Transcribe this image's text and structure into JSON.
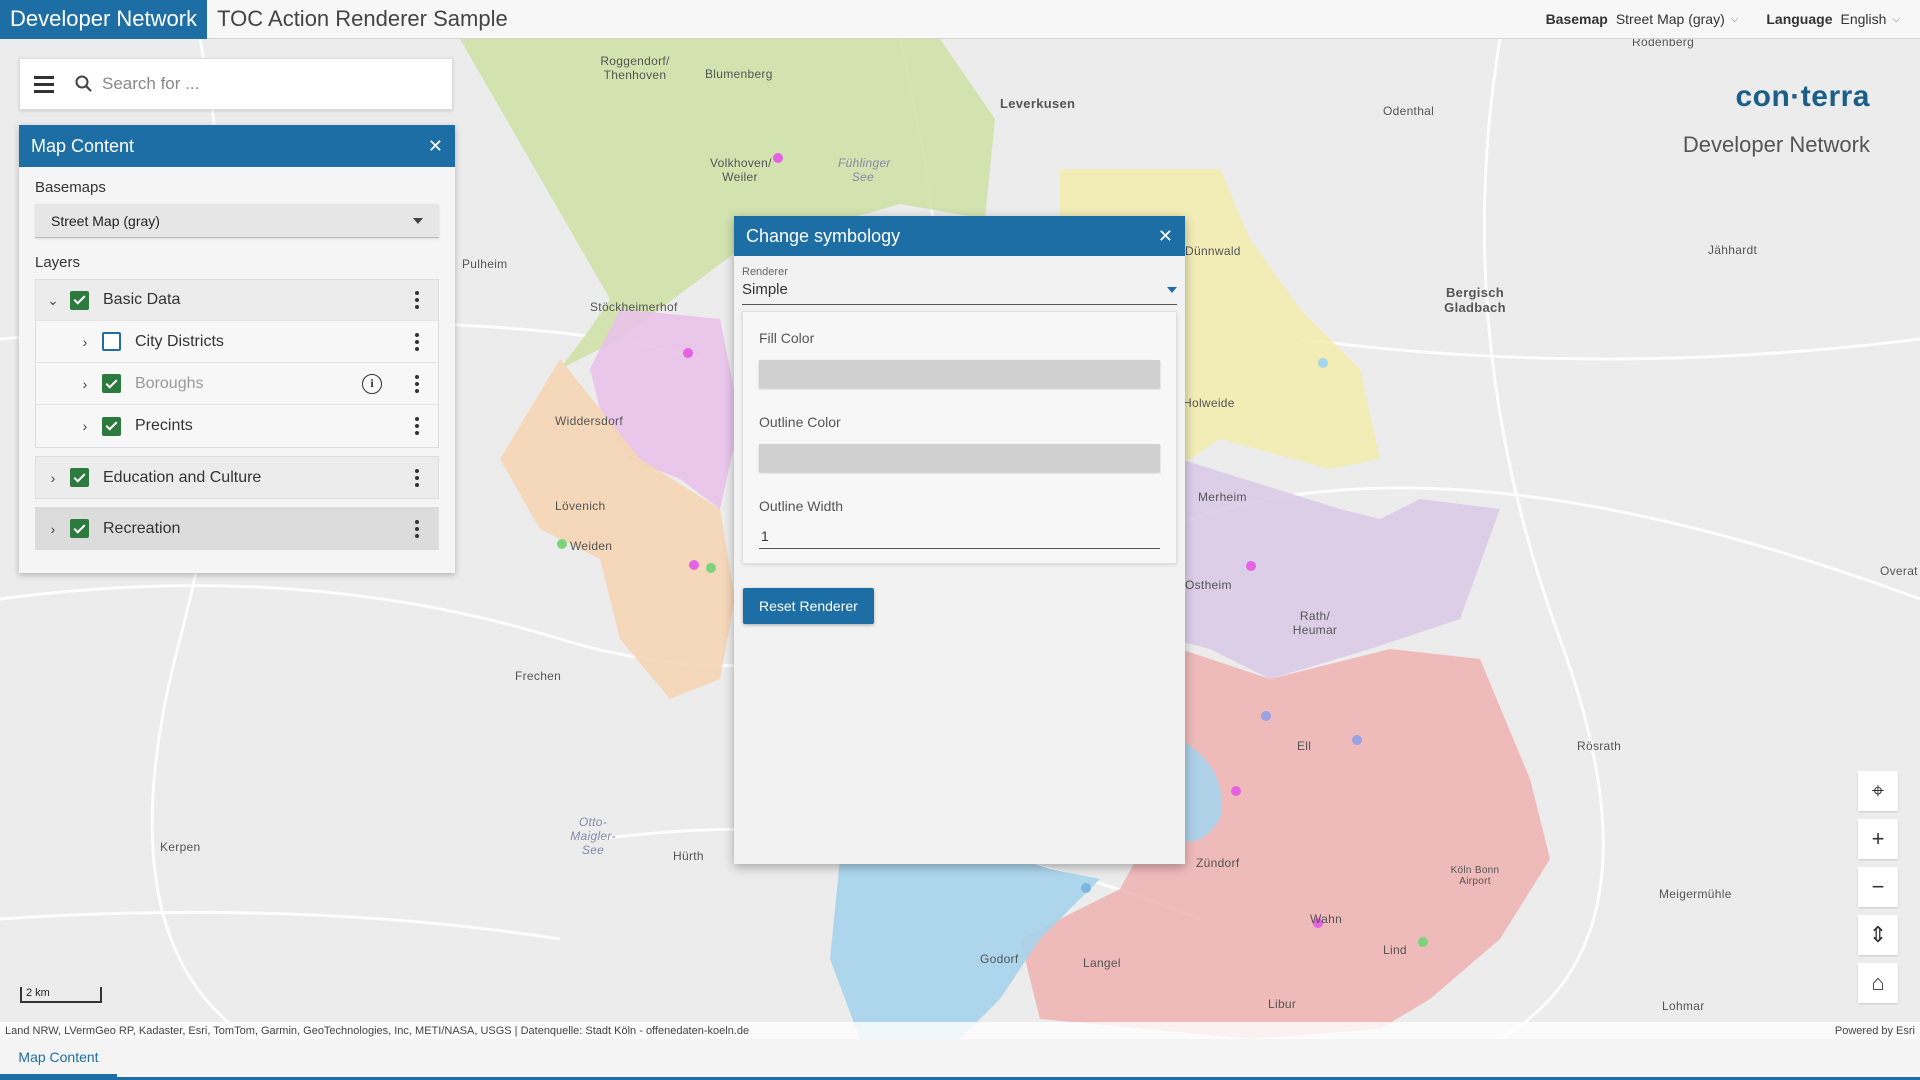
{
  "header": {
    "brand": "Developer Network",
    "title": "TOC Action Renderer Sample",
    "basemap_label": "Basemap",
    "basemap_value": "Street Map (gray)",
    "language_label": "Language",
    "language_value": "English"
  },
  "logo": {
    "main": "con·terra",
    "sub": "Developer Network"
  },
  "search": {
    "placeholder": "Search for ..."
  },
  "map_content": {
    "title": "Map Content",
    "basemaps_label": "Basemaps",
    "basemap_selected": "Street Map (gray)",
    "layers_label": "Layers",
    "layers": [
      {
        "name": "Basic Data",
        "checked": true,
        "expanded": true
      },
      {
        "name": "City Districts",
        "checked": false
      },
      {
        "name": "Boroughs",
        "checked": true
      },
      {
        "name": "Precints",
        "checked": true
      },
      {
        "name": "Education and Culture",
        "checked": true
      },
      {
        "name": "Recreation",
        "checked": true
      }
    ]
  },
  "dialog": {
    "title": "Change symbology",
    "renderer_label": "Renderer",
    "renderer_value": "Simple",
    "fill_label": "Fill Color",
    "outline_label": "Outline Color",
    "width_label": "Outline Width",
    "width_value": "1",
    "reset_label": "Reset Renderer"
  },
  "map_labels": [
    "Roggendorf/ Thenhoven",
    "Blumenberg",
    "Leverkusen",
    "Odenthal",
    "Volkhoven/ Weiler",
    "Fühlinger See",
    "Pulheim",
    "Stöckheimerhof",
    "Widdersdorf",
    "Lövenich",
    "Weiden",
    "Frechen",
    "Bergisch Gladbach",
    "Jähhardt",
    "Merheim",
    "Rath/ Heumar",
    "Ostheim",
    "Ell",
    "Rösrath",
    "Zündorf",
    "Wahn",
    "Lind",
    "Meigermühle",
    "Kerpen",
    "Hürth",
    "Otto-Maigler-See",
    "Godorf",
    "Langel",
    "Libur",
    "Lohmar",
    "Overat",
    "Köln Bonn Airport",
    "Rodenberg",
    "Dünnwald",
    "Holweide"
  ],
  "scale": "2 km",
  "attribution": {
    "text": "Land NRW, LVermGeo RP, Kadaster, Esri, TomTom, Garmin, GeoTechnologies, Inc, METI/NASA, USGS | Datenquelle: Stadt Köln - offenedaten-koeln.de",
    "powered": "Powered by Esri"
  },
  "bottom_tab": "Map Content",
  "colors": {
    "brand": "#1c6ea4",
    "region_green": "#cfe2a8",
    "region_yellow": "#f3ecb0",
    "region_pink": "#e9c2ea",
    "region_orange": "#f6d5b5",
    "region_purple": "#dccbe8",
    "region_red": "#f0b5b5",
    "region_blue": "#a6d4ec"
  }
}
